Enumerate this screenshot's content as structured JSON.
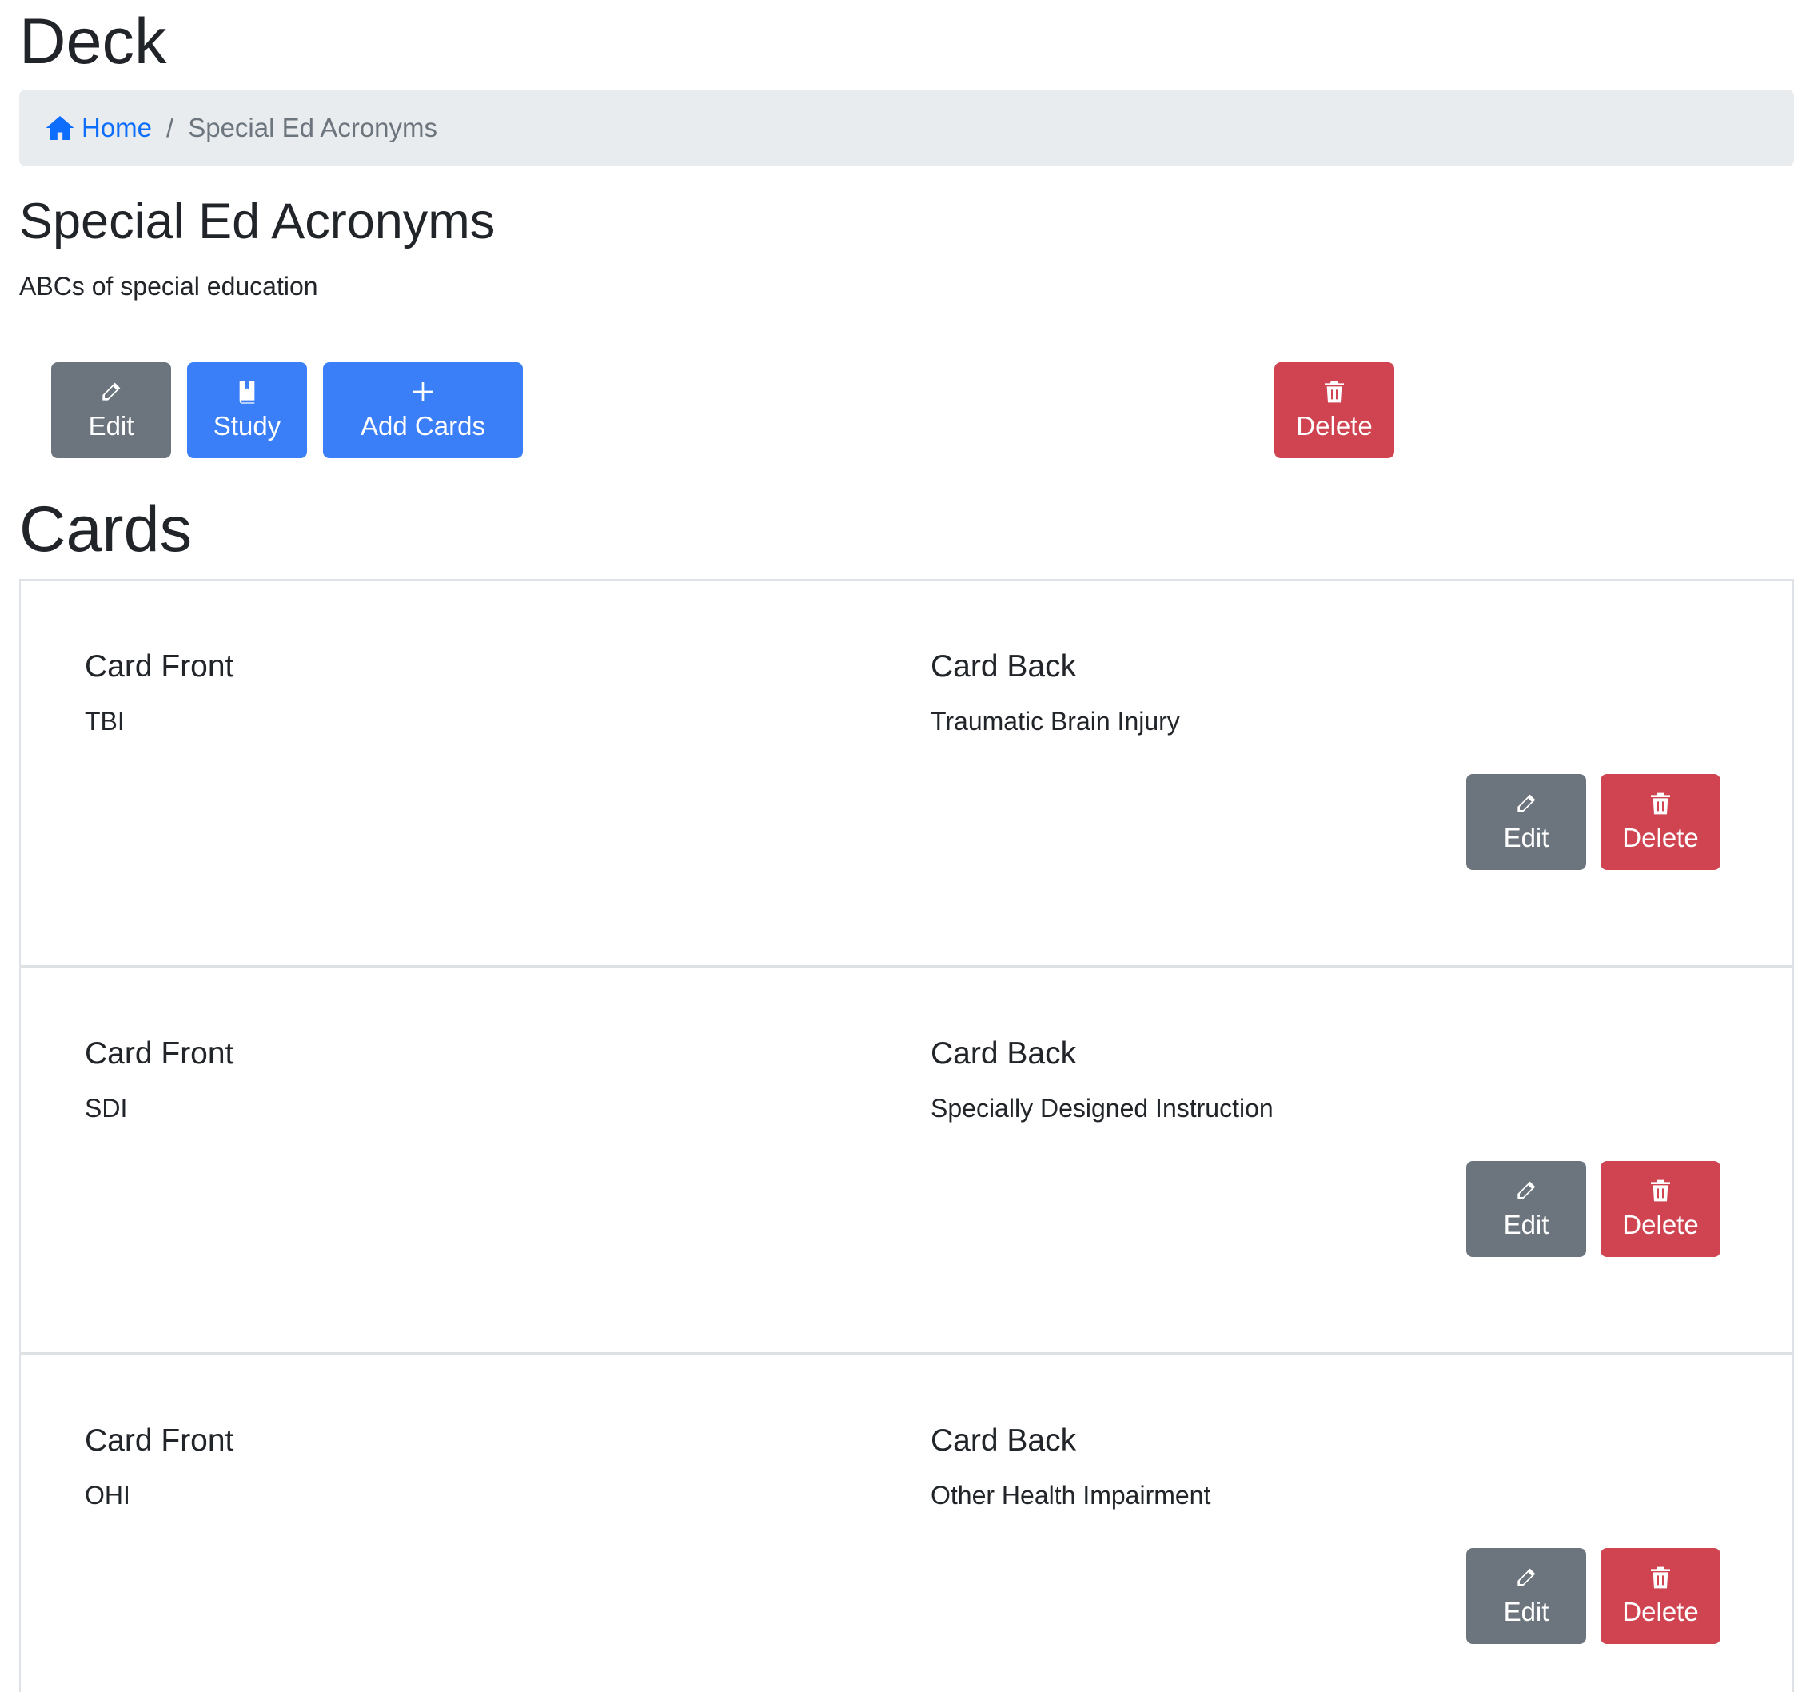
{
  "header": {
    "title": "Deck"
  },
  "breadcrumb": {
    "home_label": "Home",
    "current": "Special Ed Acronyms",
    "separator": "/"
  },
  "deck": {
    "name": "Special Ed Acronyms",
    "description": "ABCs of special education"
  },
  "toolbar": {
    "edit_label": "Edit",
    "study_label": "Study",
    "add_cards_label": "Add Cards",
    "delete_label": "Delete"
  },
  "cards_section": {
    "title": "Cards"
  },
  "cards": [
    {
      "front_label": "Card Front",
      "front": "TBI",
      "back_label": "Card Back",
      "back": "Traumatic Brain Injury",
      "edit_label": "Edit",
      "delete_label": "Delete"
    },
    {
      "front_label": "Card Front",
      "front": "SDI",
      "back_label": "Card Back",
      "back": "Specially Designed Instruction",
      "edit_label": "Edit",
      "delete_label": "Delete"
    },
    {
      "front_label": "Card Front",
      "front": "OHI",
      "back_label": "Card Back",
      "back": "Other Health Impairment",
      "edit_label": "Edit",
      "delete_label": "Delete"
    }
  ],
  "colors": {
    "primary": "#3a7ef8",
    "secondary": "#6c757d",
    "danger": "#cf4450",
    "link": "#0d6efd",
    "breadcrumb_bg": "#e9ecef"
  },
  "icons": {
    "home": "home-icon",
    "edit": "pencil-icon",
    "study": "book-icon",
    "add": "plus-icon",
    "delete": "trash-icon"
  }
}
